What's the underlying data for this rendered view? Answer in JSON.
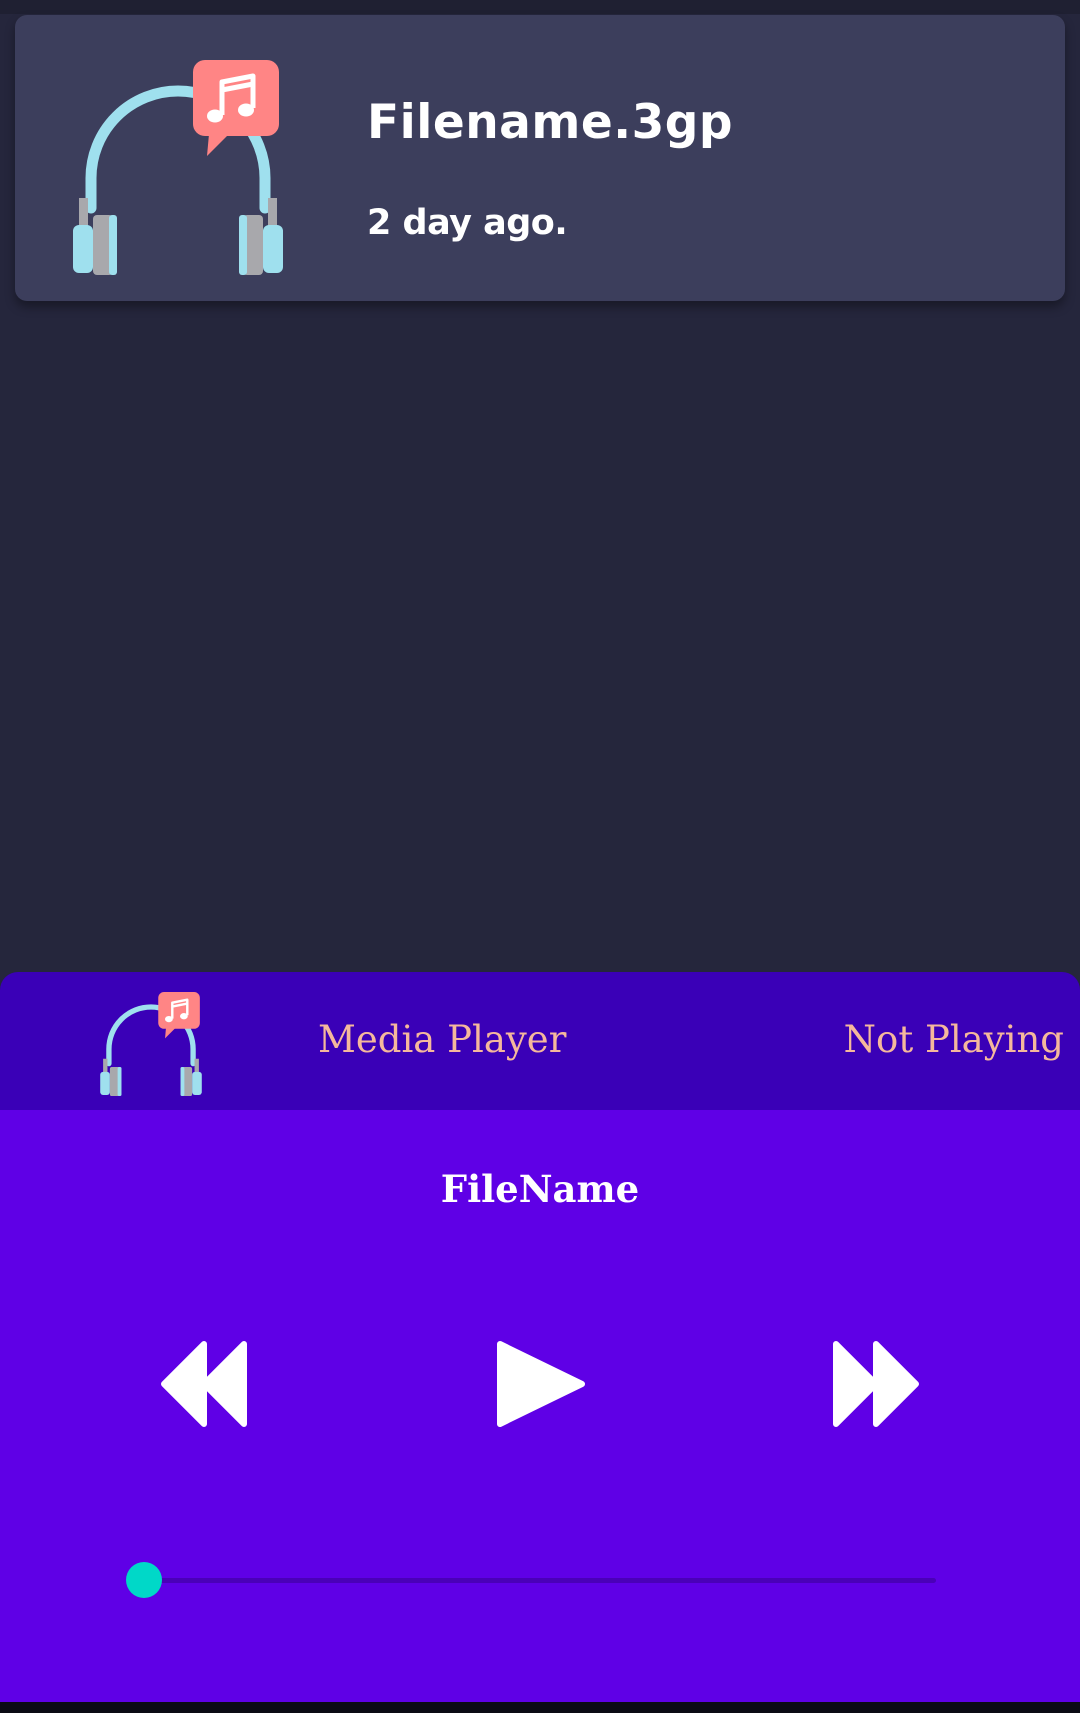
{
  "recording": {
    "title": "Filename.3gp",
    "time_ago": "2 day ago.",
    "icon": "headphones-music-icon"
  },
  "player": {
    "header_title": "Media Player",
    "status": "Not Playing",
    "header_icon": "headphones-music-icon",
    "file_name": "FileName",
    "controls": {
      "rewind_icon": "rewind-icon",
      "play_icon": "play-icon",
      "fast_forward_icon": "fast-forward-icon"
    },
    "progress": 0
  },
  "colors": {
    "background": "#25263c",
    "card": "#3c3e5c",
    "player_header": "#3a00b7",
    "player_body": "#5f00e6",
    "accent_text": "#f5b89c",
    "seek_accent": "#00d8c8"
  }
}
